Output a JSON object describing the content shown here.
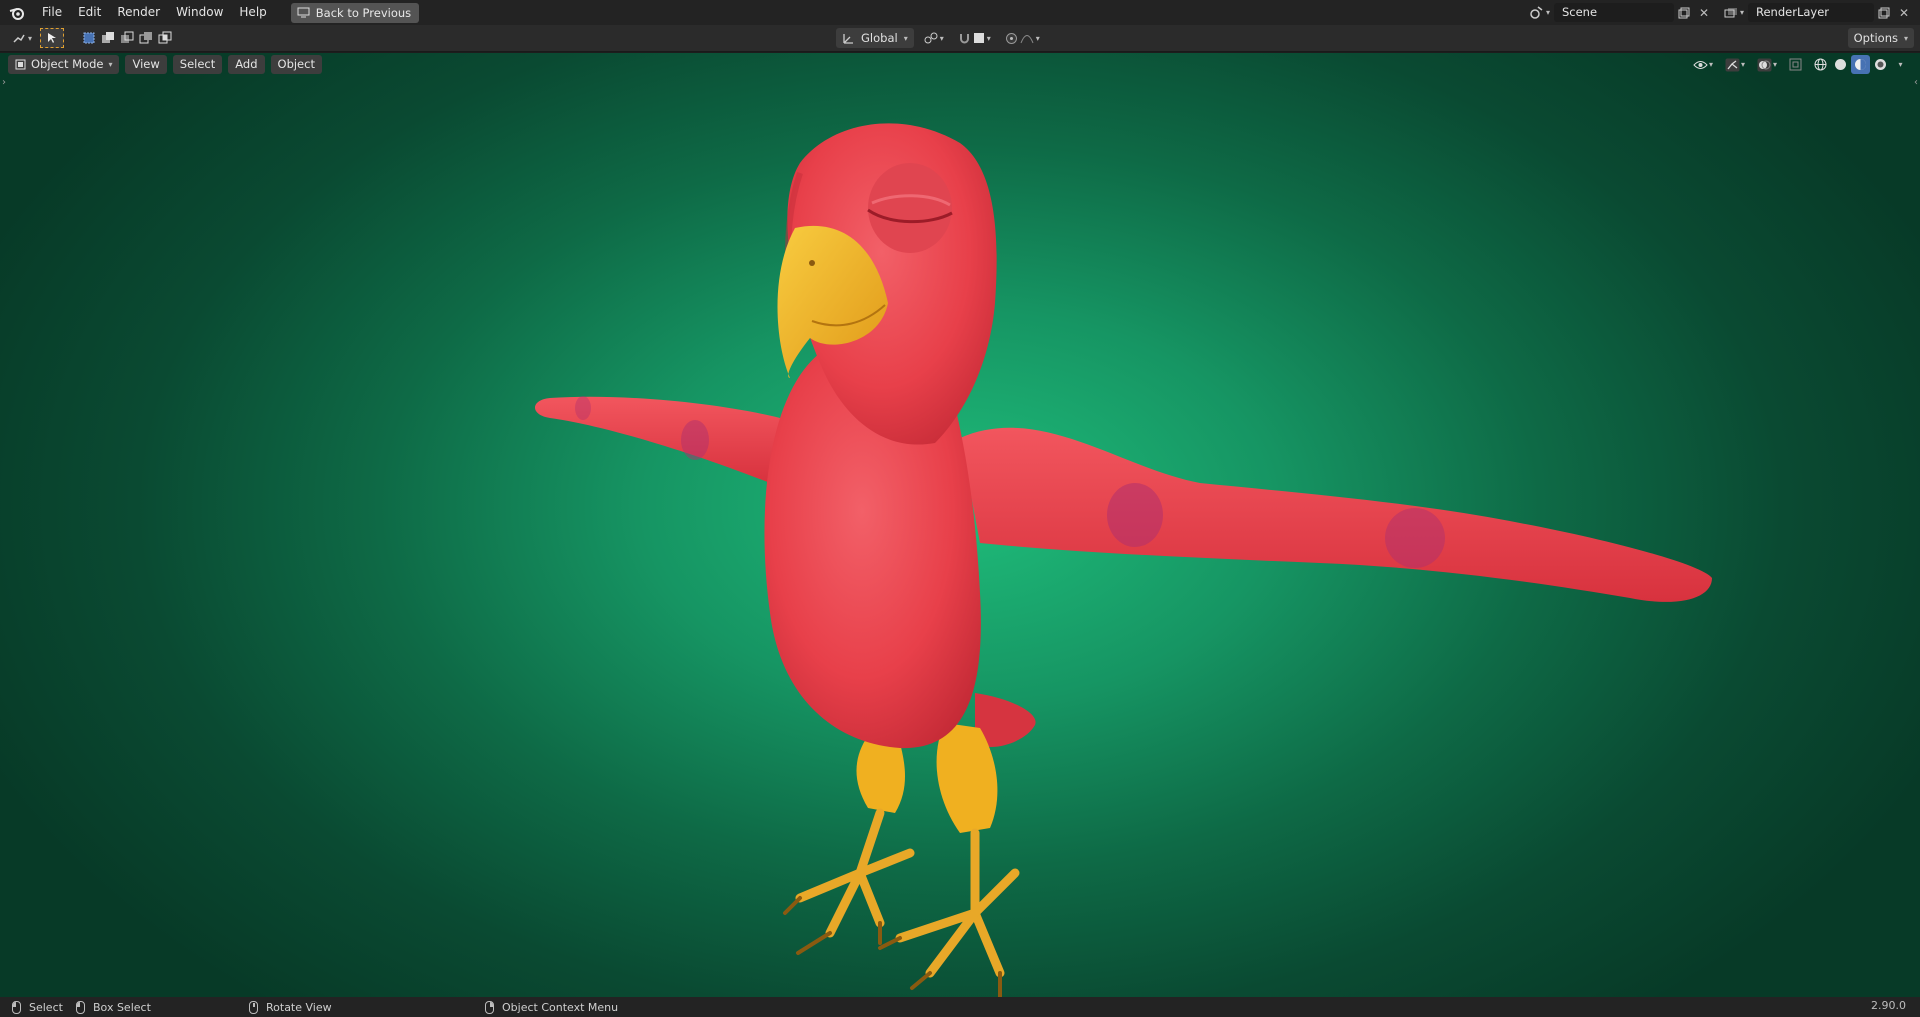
{
  "topbar": {
    "menu": [
      "File",
      "Edit",
      "Render",
      "Window",
      "Help"
    ],
    "back_button": "Back to Previous",
    "scene": "Scene",
    "render_layer": "RenderLayer"
  },
  "header2": {
    "transform_orientation": "Global",
    "options": "Options"
  },
  "viewport": {
    "mode": "Object Mode",
    "menus": [
      "View",
      "Select",
      "Add",
      "Object"
    ],
    "shading_active": "material-preview"
  },
  "statusbar": {
    "select": "Select",
    "box_select": "Box Select",
    "rotate_view": "Rotate View",
    "context_menu": "Object Context Menu",
    "version": "2.90.0"
  },
  "colors": {
    "accent": "#4772b3",
    "bird_body": "#e8404a",
    "beak": "#f0b020",
    "background_center": "#1fbc7a"
  }
}
